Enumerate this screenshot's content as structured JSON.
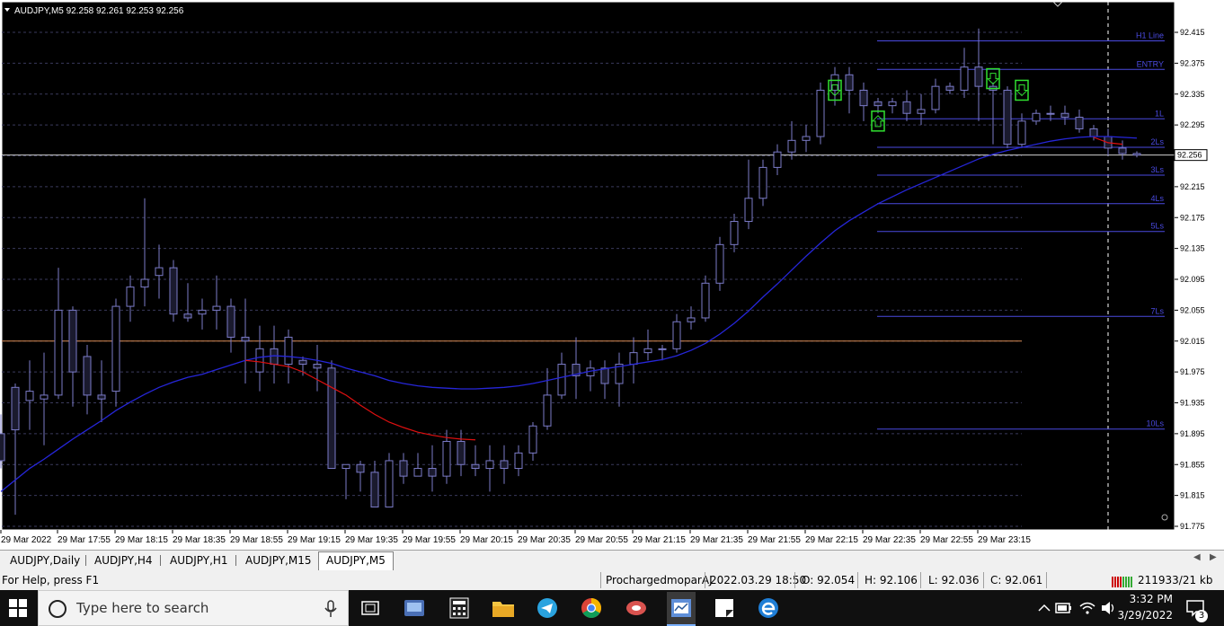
{
  "chart": {
    "header": "AUDJPY,M5  92.258 92.261 92.253 92.256",
    "price_tag": "92.256",
    "colors": {
      "background": "#000000",
      "grid": "#3a3a5c",
      "frame": "#ffffff",
      "candle": "#7b7bc8",
      "ema_blue": "#2626d9",
      "ema_red": "#e01010",
      "hline_blue": "#4a4ae0",
      "hline_orange": "#d88a50",
      "signal_green": "#30e030"
    },
    "level_labels": [
      "H1 Line",
      "ENTRY",
      "1L",
      "2Ls",
      "3Ls",
      "4Ls",
      "5Ls",
      "7Ls",
      "10Ls"
    ],
    "chart_data": {
      "type": "candlestick",
      "title": "AUDJPY,M5",
      "ohlc_header": {
        "open": 92.258,
        "high": 92.261,
        "low": 92.253,
        "close": 92.256
      },
      "y_ticks": [
        "92.415",
        "92.375",
        "92.335",
        "92.295",
        "92.255",
        "92.215",
        "92.175",
        "92.135",
        "92.095",
        "92.055",
        "92.015",
        "91.975",
        "91.935",
        "91.895",
        "91.855",
        "91.815",
        "91.775"
      ],
      "ylim": [
        91.775,
        92.415
      ],
      "x_ticks": [
        "29 Mar 2022",
        "29 Mar 17:55",
        "29 Mar 18:15",
        "29 Mar 18:35",
        "29 Mar 18:55",
        "29 Mar 19:15",
        "29 Mar 19:35",
        "29 Mar 19:55",
        "29 Mar 20:15",
        "29 Mar 20:35",
        "29 Mar 20:55",
        "29 Mar 21:15",
        "29 Mar 21:35",
        "29 Mar 21:55",
        "29 Mar 22:15",
        "29 Mar 22:35",
        "29 Mar 22:55",
        "29 Mar 23:15"
      ],
      "levels": [
        {
          "label": "H1 Line",
          "price": 92.404
        },
        {
          "label": "ENTRY",
          "price": 92.367
        },
        {
          "label": "1L",
          "price": 92.303
        },
        {
          "label": "2Ls",
          "price": 92.266
        },
        {
          "label": "3Ls",
          "price": 92.23
        },
        {
          "label": "4Ls",
          "price": 92.193
        },
        {
          "label": "5Ls",
          "price": 92.157
        },
        {
          "label": "7Ls",
          "price": 92.047
        },
        {
          "label": "10Ls",
          "price": 91.901
        }
      ],
      "orange_line": 92.015,
      "candles": [
        [
          91.895,
          91.86,
          91.92,
          91.85
        ],
        [
          91.955,
          91.9,
          91.96,
          91.79
        ],
        [
          91.938,
          91.95,
          91.99,
          91.9
        ],
        [
          91.94,
          91.945,
          92.0,
          91.88
        ],
        [
          91.945,
          92.055,
          92.11,
          91.94
        ],
        [
          92.055,
          91.975,
          92.06,
          91.93
        ],
        [
          91.995,
          91.945,
          92.01,
          91.92
        ],
        [
          91.945,
          91.94,
          91.99,
          91.91
        ],
        [
          91.95,
          92.06,
          92.07,
          91.93
        ],
        [
          92.06,
          92.085,
          92.1,
          92.04
        ],
        [
          92.085,
          92.095,
          92.2,
          92.06
        ],
        [
          92.1,
          92.11,
          92.14,
          92.07
        ],
        [
          92.11,
          92.05,
          92.12,
          92.04
        ],
        [
          92.05,
          92.045,
          92.09,
          92.04
        ],
        [
          92.05,
          92.055,
          92.07,
          92.03
        ],
        [
          92.055,
          92.06,
          92.1,
          92.03
        ],
        [
          92.06,
          92.02,
          92.07,
          92.0
        ],
        [
          92.02,
          92.015,
          92.07,
          91.96
        ],
        [
          91.975,
          92.005,
          92.035,
          91.95
        ],
        [
          92.005,
          91.985,
          92.035,
          91.96
        ],
        [
          91.985,
          92.02,
          92.03,
          91.96
        ],
        [
          91.99,
          91.985,
          91.995,
          91.97
        ],
        [
          91.985,
          91.98,
          92.01,
          91.95
        ],
        [
          91.98,
          91.85,
          91.99,
          91.85
        ],
        [
          91.85,
          91.855,
          91.855,
          91.81
        ],
        [
          91.855,
          91.845,
          91.86,
          91.82
        ],
        [
          91.845,
          91.8,
          91.86,
          91.8
        ],
        [
          91.8,
          91.86,
          91.87,
          91.8
        ],
        [
          91.86,
          91.84,
          91.87,
          91.83
        ],
        [
          91.84,
          91.85,
          91.87,
          91.84
        ],
        [
          91.85,
          91.84,
          91.88,
          91.82
        ],
        [
          91.84,
          91.885,
          91.9,
          91.83
        ],
        [
          91.885,
          91.855,
          91.9,
          91.84
        ],
        [
          91.855,
          91.85,
          91.88,
          91.84
        ],
        [
          91.85,
          91.86,
          91.88,
          91.82
        ],
        [
          91.86,
          91.85,
          91.88,
          91.83
        ],
        [
          91.85,
          91.87,
          91.88,
          91.84
        ],
        [
          91.87,
          91.905,
          91.91,
          91.86
        ],
        [
          91.905,
          91.945,
          91.98,
          91.9
        ],
        [
          91.945,
          91.985,
          92.0,
          91.94
        ],
        [
          91.985,
          91.97,
          92.02,
          91.94
        ],
        [
          91.97,
          91.98,
          91.99,
          91.95
        ],
        [
          91.98,
          91.96,
          91.99,
          91.94
        ],
        [
          91.96,
          91.985,
          92.0,
          91.93
        ],
        [
          91.985,
          92.0,
          92.02,
          91.96
        ],
        [
          92.0,
          92.005,
          92.03,
          91.99
        ],
        [
          92.005,
          92.005,
          92.01,
          91.99
        ],
        [
          92.005,
          92.04,
          92.05,
          92.0
        ],
        [
          92.04,
          92.045,
          92.06,
          92.03
        ],
        [
          92.045,
          92.09,
          92.1,
          92.04
        ],
        [
          92.09,
          92.14,
          92.15,
          92.08
        ],
        [
          92.14,
          92.17,
          92.18,
          92.13
        ],
        [
          92.17,
          92.2,
          92.25,
          92.16
        ],
        [
          92.2,
          92.24,
          92.25,
          92.19
        ],
        [
          92.24,
          92.26,
          92.27,
          92.23
        ],
        [
          92.26,
          92.275,
          92.3,
          92.25
        ],
        [
          92.275,
          92.28,
          92.295,
          92.26
        ],
        [
          92.28,
          92.34,
          92.35,
          92.27
        ],
        [
          92.34,
          92.36,
          92.37,
          92.32
        ],
        [
          92.36,
          92.34,
          92.37,
          92.31
        ],
        [
          92.34,
          92.32,
          92.35,
          92.3
        ],
        [
          92.325,
          92.32,
          92.33,
          92.31
        ],
        [
          92.32,
          92.325,
          92.33,
          92.31
        ],
        [
          92.325,
          92.31,
          92.34,
          92.3
        ],
        [
          92.31,
          92.315,
          92.335,
          92.295
        ],
        [
          92.315,
          92.345,
          92.355,
          92.31
        ],
        [
          92.345,
          92.34,
          92.35,
          92.335
        ],
        [
          92.34,
          92.37,
          92.395,
          92.33
        ],
        [
          92.37,
          92.345,
          92.42,
          92.3
        ],
        [
          92.345,
          92.34,
          92.35,
          92.27
        ],
        [
          92.34,
          92.27,
          92.345,
          92.265
        ],
        [
          92.27,
          92.3,
          92.31,
          92.265
        ],
        [
          92.3,
          92.31,
          92.315,
          92.295
        ],
        [
          92.31,
          92.31,
          92.32,
          92.3
        ],
        [
          92.31,
          92.305,
          92.32,
          92.295
        ],
        [
          92.305,
          92.29,
          92.315,
          92.285
        ],
        [
          92.29,
          92.28,
          92.295,
          92.275
        ],
        [
          92.28,
          92.265,
          92.29,
          92.255
        ],
        [
          92.265,
          92.258,
          92.275,
          92.25
        ],
        [
          92.258,
          92.256,
          92.261,
          92.253
        ]
      ],
      "ema_blue": [
        91.82,
        91.835,
        91.85,
        91.862,
        91.875,
        91.888,
        91.9,
        91.912,
        91.925,
        91.936,
        91.946,
        91.955,
        91.962,
        91.968,
        91.972,
        91.978,
        91.984,
        91.99,
        91.994,
        91.996,
        91.995,
        91.993,
        91.99,
        91.986,
        91.98,
        91.975,
        91.97,
        91.964,
        91.96,
        91.957,
        91.955,
        91.954,
        91.953,
        91.953,
        91.954,
        91.955,
        91.957,
        91.96,
        91.964,
        91.968,
        91.972,
        91.976,
        91.979,
        91.982,
        91.985,
        91.988,
        91.991,
        91.996,
        92.003,
        92.012,
        92.024,
        92.038,
        92.054,
        92.072,
        92.089,
        92.107,
        92.125,
        92.142,
        92.158,
        92.171,
        92.182,
        92.193,
        92.202,
        92.211,
        92.219,
        92.227,
        92.235,
        92.243,
        92.251,
        92.257,
        92.262,
        92.266,
        92.27,
        92.274,
        92.277,
        92.279,
        92.28,
        92.28,
        92.279,
        92.278
      ],
      "signals": [
        {
          "candle": 58,
          "direction": "down",
          "price": 92.34
        },
        {
          "candle": 61,
          "direction": "up",
          "price": 92.3
        },
        {
          "candle": 69,
          "direction": "down",
          "price": 92.355
        },
        {
          "candle": 71,
          "direction": "down",
          "price": 92.34
        }
      ]
    }
  },
  "tabs": [
    "AUDJPY,Daily",
    "AUDJPY,H4",
    "AUDJPY,H1",
    "AUDJPY,M15",
    "AUDJPY,M5"
  ],
  "active_tab": "AUDJPY,M5",
  "status": {
    "help": "For Help, press F1",
    "profile": "ProchargedmoparAJ",
    "datetime": "2022.03.29 18:50",
    "open": "O: 92.054",
    "high": "H: 92.106",
    "low": "L: 92.036",
    "close": "C: 92.061",
    "traffic": "211933/21 kb"
  },
  "taskbar": {
    "search_placeholder": "Type here to search",
    "time": "3:32 PM",
    "date": "3/29/2022",
    "notification_count": "3",
    "icons": [
      "windows-icon",
      "microphone-icon",
      "task-view-icon",
      "app-icon",
      "calculator-icon",
      "file-explorer-icon",
      "telegram-icon",
      "chrome-icon",
      "app2-icon",
      "mt4-icon",
      "sticky-notes-icon",
      "edge-icon"
    ]
  }
}
